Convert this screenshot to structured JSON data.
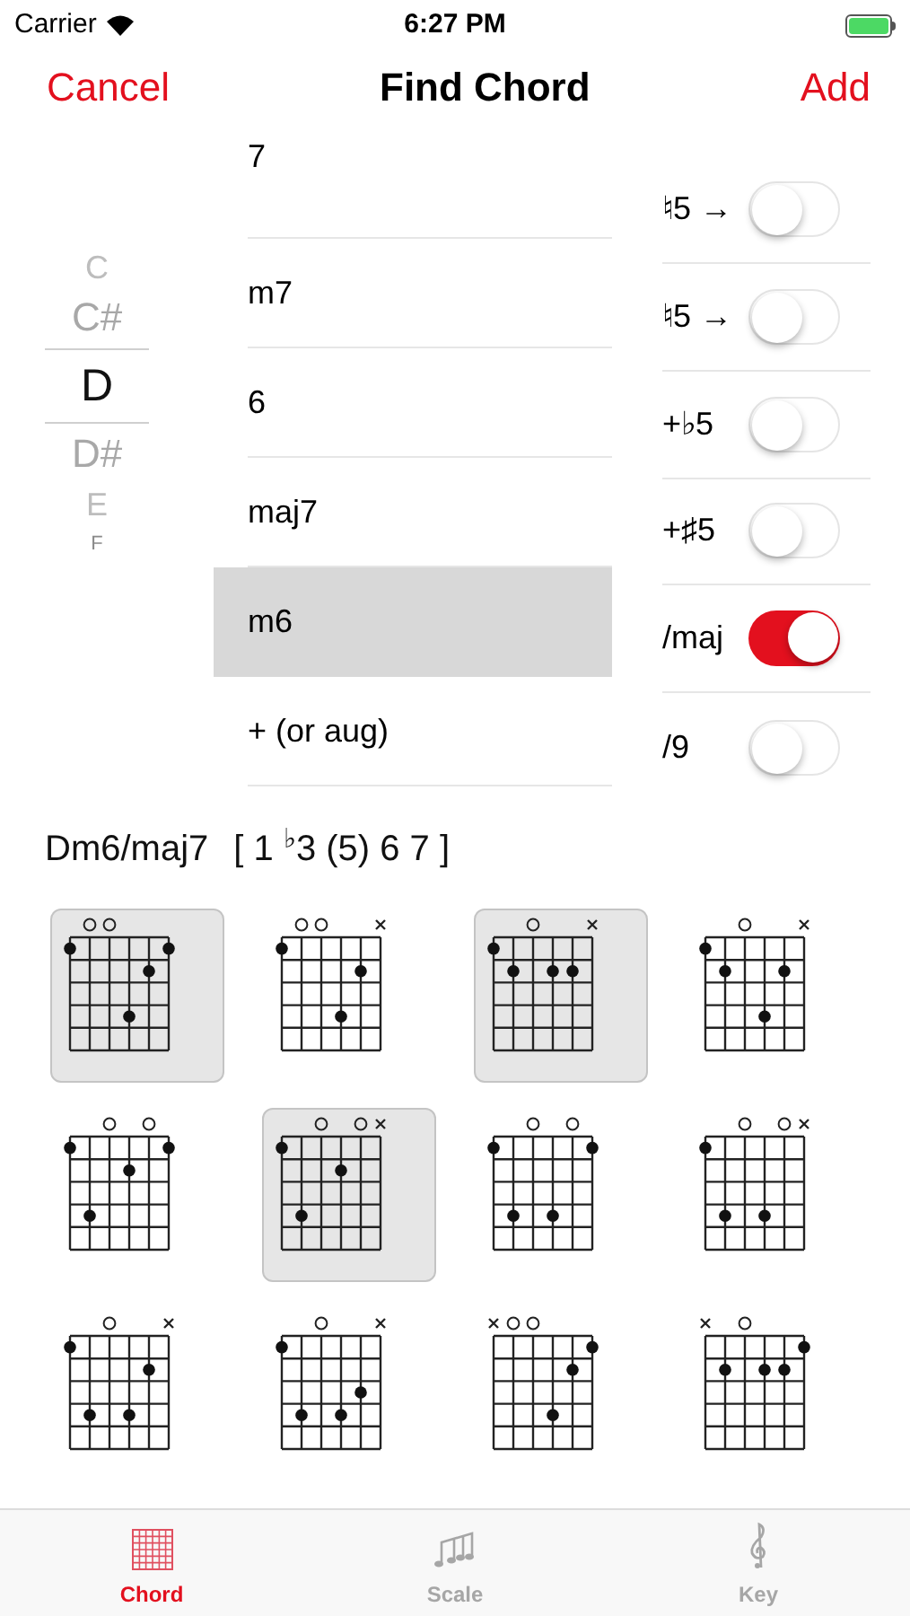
{
  "status_bar": {
    "carrier": "Carrier",
    "time": "6:27 PM"
  },
  "nav": {
    "cancel": "Cancel",
    "title": "Find Chord",
    "add": "Add"
  },
  "roots": [
    {
      "label": "C",
      "selected": false
    },
    {
      "label": "C#",
      "selected": false
    },
    {
      "label": "D",
      "selected": true
    },
    {
      "label": "D#",
      "selected": false
    },
    {
      "label": "E",
      "selected": false
    },
    {
      "label": "F",
      "selected": false
    }
  ],
  "qualities": [
    {
      "label": "7",
      "selected": false
    },
    {
      "label": "m7",
      "selected": false
    },
    {
      "label": "6",
      "selected": false
    },
    {
      "label": "maj7",
      "selected": false
    },
    {
      "label": "m6",
      "selected": true
    },
    {
      "label": "+ (or aug)",
      "selected": false
    }
  ],
  "options": [
    {
      "label": "♮5 →",
      "on": false
    },
    {
      "label": "♮5 →",
      "on": false
    },
    {
      "label": "+♭5",
      "on": false
    },
    {
      "label": "+♯5",
      "on": false
    },
    {
      "label": "/maj",
      "on": true
    },
    {
      "label": "/9",
      "on": false
    }
  ],
  "chord": {
    "name": "Dm6/maj7",
    "formula": "[ 1 $^{♭}$3 (5) 6 7 ]"
  },
  "voicings": [
    {
      "selected": true
    },
    {
      "selected": false
    },
    {
      "selected": true
    },
    {
      "selected": false
    },
    {
      "selected": false
    },
    {
      "selected": true
    },
    {
      "selected": false
    },
    {
      "selected": false
    },
    {
      "selected": false
    },
    {
      "selected": false
    },
    {
      "selected": false
    },
    {
      "selected": false
    }
  ],
  "tabs": [
    {
      "label": "Chord",
      "selected": true
    },
    {
      "label": "Scale",
      "selected": false
    },
    {
      "label": "Key",
      "selected": false
    }
  ]
}
